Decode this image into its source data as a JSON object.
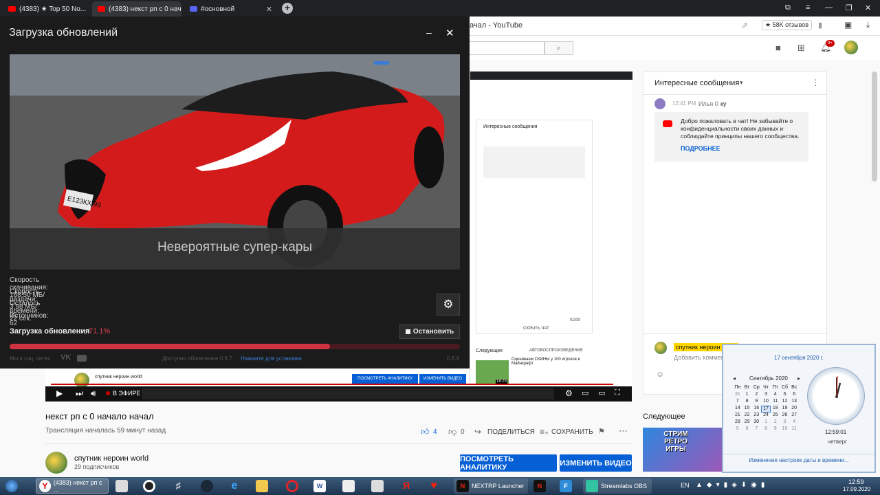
{
  "tabs": [
    {
      "label": "(4383) ★ Top 50 No..."
    },
    {
      "label": "(4383) некст рп с 0 нач..."
    },
    {
      "label": "#основной"
    }
  ],
  "browser": {
    "page_title_fragment": "ачал - YouTube",
    "rating": "★ 58K отзывов"
  },
  "dialog": {
    "title": "Загрузка обновлений",
    "banner_caption": "Невероятные супер-кары",
    "license_plate": "Е123КХ 99",
    "stats": [
      {
        "label": "Скорость скачивания:",
        "value": "168.50 МБ/с"
      },
      {
        "label": "Скорость раздачи:",
        "value": "3.98 МБ/с"
      },
      {
        "label": "Осталось времени:",
        "value": "22 сек."
      },
      {
        "label": "Источников:",
        "value": "62"
      }
    ],
    "progress_label": "Загрузка обновления",
    "progress_percent_text": "71.1%",
    "progress_fraction": 0.711,
    "stop_label": "Остановить",
    "social_label": "Мы в соц. сетях",
    "update_available": "Доступно обновление 0.9.7",
    "install_link": "Нажмите для установки",
    "version": "0.8.9"
  },
  "video_inner": {
    "live_label": "В ЭФИРЕ",
    "channel": "спутник нероин world",
    "analytics_btn": "ПОСМОТРЕТЬ АНАЛИТИКУ",
    "edit_btn": "ИЗМЕНИТЬ ВИДЕО",
    "chat_title": "Интересные сообщения",
    "next_label": "Следующее",
    "autoplay_label": "АВТОВОСПРОИЗВЕДЕНИЕ",
    "suggest_title": "Оцениваем СКИНЫ у 100 игроков в Майнкрафт",
    "suggest_duration": "18:23",
    "hide_chat": "СКРЫТЬ ЧАТ",
    "counter": "0/200"
  },
  "chat": {
    "title": "Интересные сообщения",
    "time": "12:41 PM",
    "user": "Илья 0",
    "user_msg": "ку",
    "notice": "Добро пожаловать в чат! Не забывайте о конфиденциальности своих данных и соблюдайте принципы нашего сообщества.",
    "more": "ПОДРОБНЕЕ",
    "me": "спутник нероин world",
    "add_comment": "Добавить коммент..."
  },
  "video_info": {
    "title": "некст рп с 0 начало начал",
    "started": "Трансляция началась 59 минут назад",
    "likes": "4",
    "dislikes": "0",
    "share": "ПОДЕЛИТЬСЯ",
    "save": "СОХРАНИТЬ",
    "channel": "спутник нероин world",
    "subs": "29 подписчиков",
    "analytics_btn": "ПОСМОТРЕТЬ АНАЛИТИКУ",
    "edit_btn": "ИЗМЕНИТЬ ВИДЕО",
    "next_label": "Следующее",
    "thumb_text": "СТРИМ РЕТРО ИГРЫ"
  },
  "calendar": {
    "date_long": "17 сентября 2020 г.",
    "month": "Сентябрь 2020",
    "weekdays": [
      "Пн",
      "Вт",
      "Ср",
      "Чт",
      "Пт",
      "Сб",
      "Вс"
    ],
    "weeks": [
      [
        "31",
        "1",
        "2",
        "3",
        "4",
        "5",
        "6"
      ],
      [
        "7",
        "8",
        "9",
        "10",
        "11",
        "12",
        "13"
      ],
      [
        "14",
        "15",
        "16",
        "17",
        "18",
        "19",
        "20"
      ],
      [
        "21",
        "22",
        "23",
        "24",
        "25",
        "26",
        "27"
      ],
      [
        "28",
        "29",
        "30",
        "1",
        "2",
        "3",
        "4"
      ],
      [
        "5",
        "6",
        "7",
        "8",
        "9",
        "10",
        "11"
      ]
    ],
    "time": "12:59:01",
    "day": "четверг",
    "settings_link": "Изменение настроек даты и времени..."
  },
  "taskbar": {
    "yt_task": "(4383) некст рп с ...",
    "nextrp_task": "NEXTRP Launcher",
    "obs_task": "Streamlabs OBS",
    "lang": "EN",
    "clock_time": "12:59",
    "clock_date": "17.09.2020"
  }
}
